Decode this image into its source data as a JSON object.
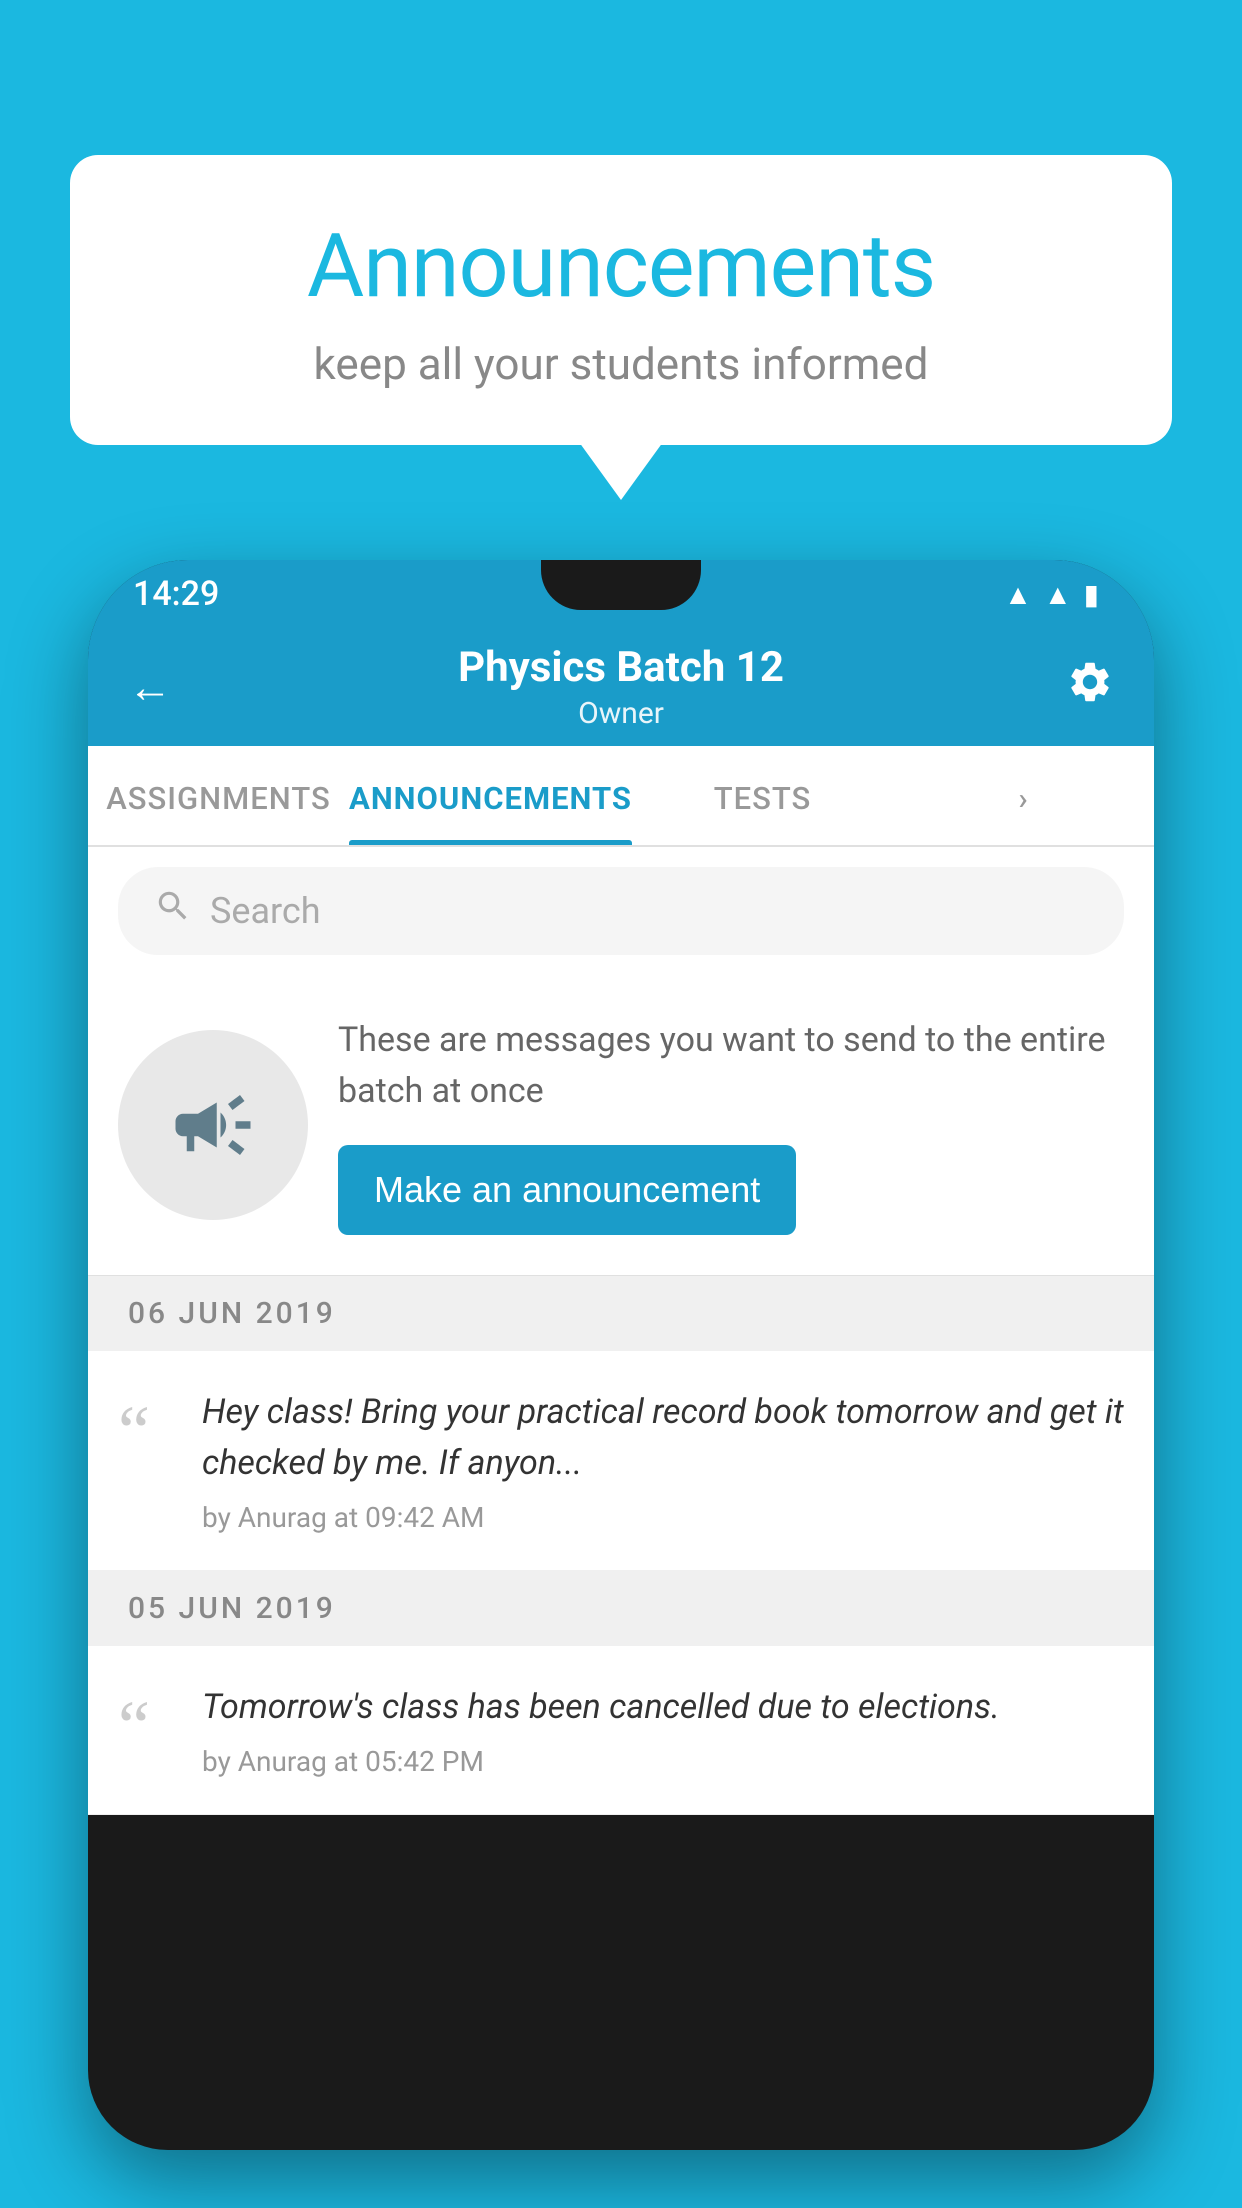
{
  "background_color": "#1BB8E0",
  "speech_bubble": {
    "title": "Announcements",
    "subtitle": "keep all your students informed"
  },
  "phone": {
    "status_bar": {
      "time": "14:29",
      "wifi_icon": "wifi-icon",
      "signal_icon": "signal-icon",
      "battery_icon": "battery-icon"
    },
    "app_bar": {
      "back_icon": "back-arrow-icon",
      "title": "Physics Batch 12",
      "subtitle": "Owner",
      "settings_icon": "gear-icon"
    },
    "tabs": [
      {
        "label": "ASSIGNMENTS",
        "active": false
      },
      {
        "label": "ANNOUNCEMENTS",
        "active": true
      },
      {
        "label": "TESTS",
        "active": false
      },
      {
        "label": "...",
        "active": false
      }
    ],
    "search": {
      "placeholder": "Search",
      "search_icon": "search-icon"
    },
    "promo": {
      "icon": "megaphone-icon",
      "text": "These are messages you want to send to the entire batch at once",
      "button_label": "Make an announcement"
    },
    "announcements": [
      {
        "date": "06  JUN  2019",
        "message": "Hey class! Bring your practical record book tomorrow and get it checked by me. If anyon...",
        "meta": "by Anurag at 09:42 AM"
      },
      {
        "date": "05  JUN  2019",
        "message": "Tomorrow's class has been cancelled due to elections.",
        "meta": "by Anurag at 05:42 PM"
      }
    ]
  }
}
